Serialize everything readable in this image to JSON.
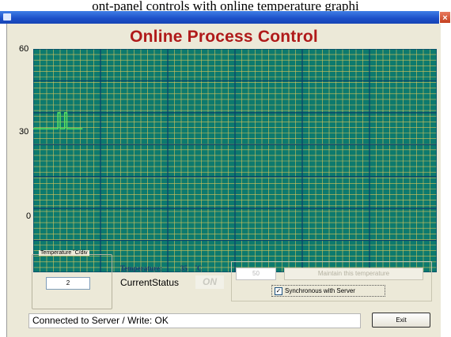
{
  "caption": "ont-panel controls with online temperature graphi",
  "app": {
    "title": "Online Process Control"
  },
  "chart": {
    "y_ticks": [
      "60",
      "30",
      "0"
    ],
    "background": "#0d7a6e",
    "grid_minor": "#d8c45a",
    "grid_major": "#0a3f6b",
    "trace_color": "#59e35f"
  },
  "chart_data": {
    "type": "line",
    "title": "",
    "xlabel": "",
    "ylabel": "",
    "ylim": [
      -10,
      60
    ],
    "grid": true,
    "series": [
      {
        "x": [
          0,
          6,
          11,
          11,
          12,
          12,
          14,
          14,
          15,
          15,
          22
        ],
        "y": [
          35,
          35,
          35,
          40,
          40,
          35,
          35,
          40,
          40,
          35,
          35
        ]
      }
    ]
  },
  "scale_group": {
    "legend": "Temperature ˚C/div",
    "value": "2"
  },
  "temperature": {
    "label": "Temperature:",
    "value": "35",
    "unit": "˚C"
  },
  "current_status": {
    "label": "CurrentStatus",
    "value": "ON"
  },
  "maintain": {
    "value": "50",
    "button_label": "Maintain this temperature"
  },
  "sync": {
    "label": "Synchronous with Server",
    "checked": true,
    "mark": "✓"
  },
  "status_bar": {
    "text": "Connected to Server / Write: OK"
  },
  "exit": {
    "label": "Exit"
  },
  "window": {
    "close_glyph": "×"
  }
}
